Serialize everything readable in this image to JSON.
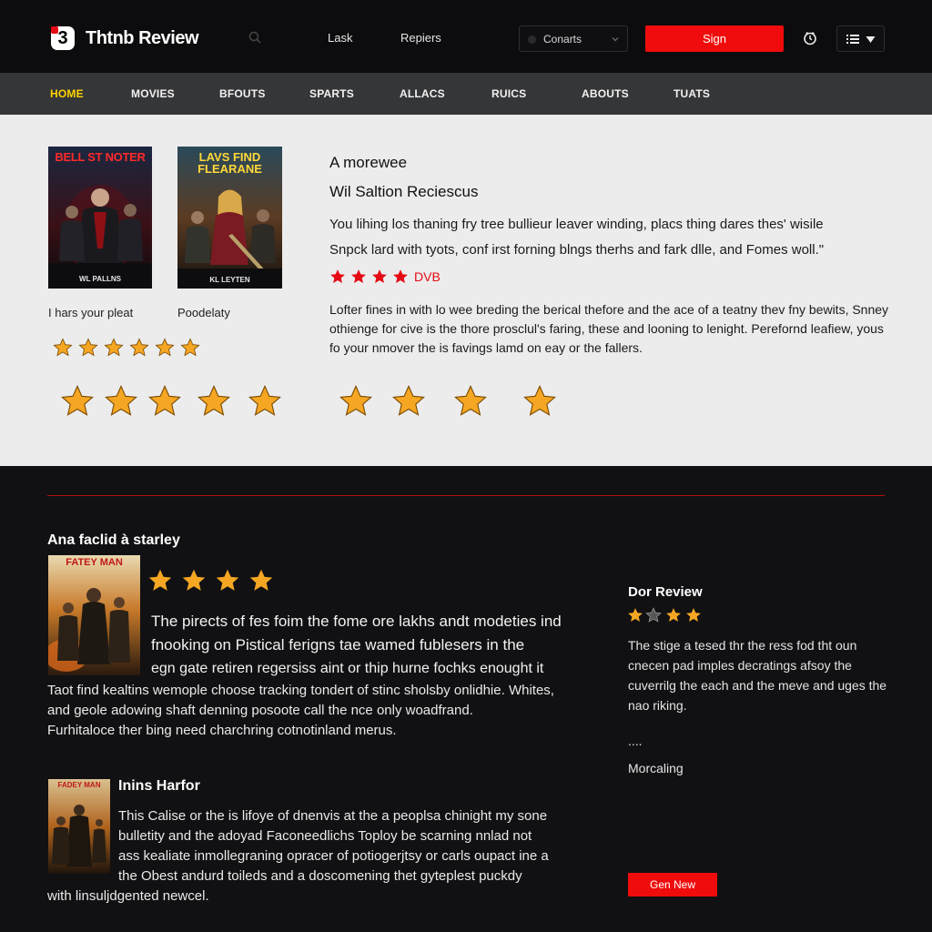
{
  "header": {
    "logo_glyph": "3",
    "site_title": "Thtnb Review",
    "nav_links": [
      "Lask",
      "Repiers"
    ],
    "select_value": "Conarts",
    "signin_label": "Sign",
    "icons": [
      "search-icon",
      "clock-icon",
      "list-icon",
      "chevron-down-icon"
    ]
  },
  "categories": {
    "items": [
      "HOME",
      "MOVIES",
      "BFOUTS",
      "SPARTS",
      "ALLACS",
      "RUICS",
      "ABOUTS",
      "TUATS"
    ],
    "active_color": "#ffd400"
  },
  "featured": {
    "poster1": {
      "title": "BELL ST NOTER",
      "footer": "WL PALLNS"
    },
    "poster2": {
      "title": "LAVS FIND FLEARANE",
      "footer": "KL LEYTEN"
    },
    "caption1": "I hars your pleat",
    "caption2": "Poodelaty",
    "title": "A morewee",
    "subtitle": "Wil Saltion Reciescus",
    "text_line1": "You lihing los thaning fry tree bullieur leaver winding, placs thing dares thes' wisile",
    "text_line2": "Snpck lard with tyots, conf irst forning blngs therhs and fark dlle, and Fomes woll.\"",
    "rating_text": "DVB",
    "text2": "Lofter fines in with lo wee breding the berical thefore and the ace of a teatny thev fny bewits, Snney othienge for cive is the thore prosclul's faring, these and looning to lenight. Perefornd leafiew, yous fo your nmover the is favings lamd on eay or the fallers."
  },
  "reviews": {
    "section_title": "Ana faclid à starley",
    "review1": {
      "poster_title": "FATEY MAN",
      "line1": "The pirects of fes foim the fome ore lakhs andt modeties ind",
      "line2": "fnooking on Pistical ferigns tae wamed fublesers in the",
      "line3": "egn gate retiren regersiss aint or thip hurne fochks enought it",
      "line4": "Taot find kealtins wemople choose tracking tondert of stinc sholsby onlidhie. Whites,",
      "line5": "and geole adowing shaft denning posoote call the nce only woadfrand.",
      "line6": "Furhitaloce ther bing need charchring cotnotinland merus."
    },
    "review2": {
      "poster_title": "FADEY MAN",
      "title": "Inins Harfor",
      "line1": "This Calise or the is lifoye of dnenvis at the a peoplsa chinight my sone",
      "line2": "bulletity and the adoyad Faconeedlichs Toploy be scarning nnlad not",
      "line3": "ass kealiate inmollegraning opracer of potiogerjtsy or carls oupact ine a",
      "line4": "the Obest andurd toileds and a doscomening thet gyteplest puckdy",
      "line5": "with linsuljdgented newcel."
    }
  },
  "sidebar": {
    "title": "Dor Review",
    "rating": 3,
    "text": "The stige a tesed thr the ress fod tht oun cnecen pad imples decratings afsoy the cuverrilg the each and the meve and uges the nao riking.",
    "dots": "....",
    "more_label": "Morcaling",
    "button_label": "Gen New"
  },
  "colors": {
    "accent_red": "#f00c0c",
    "star_gold": "#f5a623",
    "star_red": "#e50914",
    "nav_bg": "#353638",
    "panel_bg": "#ececec"
  }
}
